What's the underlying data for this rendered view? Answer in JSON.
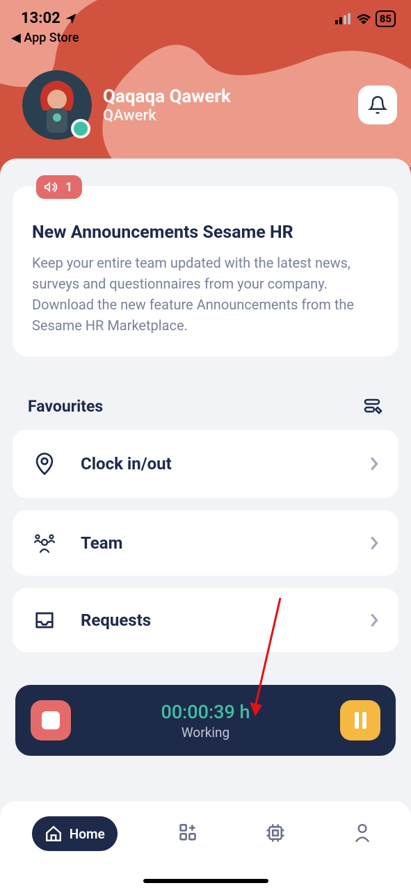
{
  "status_bar": {
    "time": "13:02",
    "back_link": "◀ App Store",
    "battery": "85"
  },
  "profile": {
    "name": "Qaqaqa Qawerk",
    "company": "QAwerk"
  },
  "announcement": {
    "badge_count": "1",
    "title": "New Announcements Sesame HR",
    "body": "Keep your entire team updated with the latest news, surveys and questionnaires from your company. Download the new feature Announcements from the Sesame HR Marketplace."
  },
  "favourites": {
    "title": "Favourites",
    "items": [
      {
        "label": "Clock in/out"
      },
      {
        "label": "Team"
      },
      {
        "label": "Requests"
      }
    ]
  },
  "timer": {
    "time": "00:00:39 h",
    "status": "Working"
  },
  "nav": {
    "home": "Home"
  }
}
